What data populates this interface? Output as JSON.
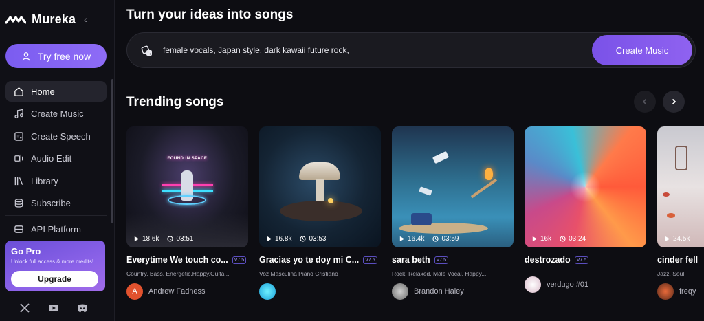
{
  "brand": {
    "name": "Mureka"
  },
  "sidebar": {
    "try_button": "Try free now",
    "items": [
      {
        "label": "Home",
        "icon": "home-icon",
        "active": true
      },
      {
        "label": "Create Music",
        "icon": "music-note-icon"
      },
      {
        "label": "Create Speech",
        "icon": "speech-icon"
      },
      {
        "label": "Audio Edit",
        "icon": "audio-edit-icon"
      },
      {
        "label": "Library",
        "icon": "library-icon"
      },
      {
        "label": "Subscribe",
        "icon": "subscribe-icon"
      },
      {
        "label": "API Platform",
        "icon": "api-icon"
      }
    ],
    "pro": {
      "title": "Go Pro",
      "subtitle": "Unlock full access & more credits!",
      "button": "Upgrade"
    },
    "socials": [
      "x-icon",
      "youtube-icon",
      "discord-icon"
    ]
  },
  "hero": {
    "title": "Turn your ideas into songs",
    "prompt": "female vocals, Japan style, dark kawaii future rock,",
    "create_button": "Create Music"
  },
  "trending": {
    "title": "Trending songs",
    "songs": [
      {
        "title": "Everytime We touch co...",
        "version": "V7.5",
        "plays": "18.6k",
        "duration": "03:51",
        "tags": "Country, Bass, Energetic,Happy,Guita...",
        "author": "Andrew Fadness",
        "avatar_letter": "A",
        "cover_text": "FOUND IN SPACE"
      },
      {
        "title": "Gracias yo te doy mi C...",
        "version": "V7.5",
        "plays": "16.8k",
        "duration": "03:53",
        "tags": "Voz Masculina Piano Cristiano",
        "author": ""
      },
      {
        "title": "sara beth",
        "version": "V7.5",
        "plays": "16.4k",
        "duration": "03:59",
        "tags": "Rock,  Relaxed,  Male Vocal,  Happy...",
        "author": "Brandon Haley"
      },
      {
        "title": "destrozado",
        "version": "V7.5",
        "plays": "16k",
        "duration": "03:24",
        "tags": "",
        "author": "verdugo #01"
      },
      {
        "title": "cinder fell",
        "version": "",
        "plays": "24.5k",
        "duration": "",
        "tags": "Jazz,  Soul,",
        "author": "freqy"
      }
    ]
  }
}
